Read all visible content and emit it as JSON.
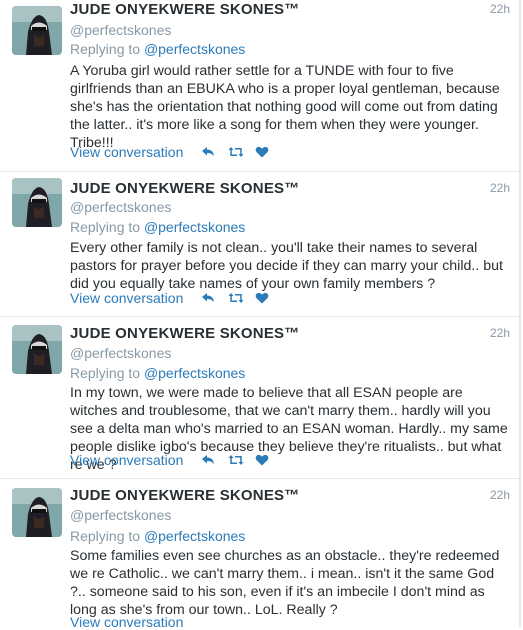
{
  "tweets": [
    {
      "name": "JUDE ONYEKWERE SKONES™",
      "handle": "@perfectskones",
      "time": "22h",
      "replying_prefix": "Replying to ",
      "replying_to": "@perfectskones",
      "text": "A Yoruba girl would rather settle for a TUNDE with four to five girlfriends than an EBUKA who is a proper loyal gentleman, because she's has the orientation that nothing good will come out from dating the latter.. it's more like a song for them when they were younger. Tribe!!!",
      "view_conversation": "View conversation"
    },
    {
      "name": "JUDE ONYEKWERE SKONES™",
      "handle": "@perfectskones",
      "time": "22h",
      "replying_prefix": "Replying to ",
      "replying_to": "@perfectskones",
      "text": "Every other family is not clean.. you'll take their names to several pastors for prayer before you decide if they can marry your child.. but did you equally take names of your own family members ?",
      "view_conversation": "View conversation"
    },
    {
      "name": "JUDE ONYEKWERE SKONES™",
      "handle": "@perfectskones",
      "time": "22h",
      "replying_prefix": "Replying to ",
      "replying_to": "@perfectskones",
      "text": "In my town, we were made to believe that all ESAN people are witches and troublesome, that we can't marry them.. hardly will you see a delta man who's married to an ESAN woman. Hardly.. my same people dislike igbo's because they believe they're ritualists.. but what re we ?",
      "view_conversation": "View conversation"
    },
    {
      "name": "JUDE ONYEKWERE SKONES™",
      "handle": "@perfectskones",
      "time": "22h",
      "replying_prefix": "Replying to ",
      "replying_to": "@perfectskones",
      "text": "Some families even see churches as an obstacle.. they're redeemed we re Catholic.. we can't marry them.. i mean.. isn't it the same God ?.. someone said to his son, even if it's an imbecile I don't mind as long as she's from our town.. LoL. Really ?",
      "view_conversation": "View conversation"
    }
  ],
  "icons": {
    "reply": "reply-icon",
    "retweet": "retweet-icon",
    "like": "heart-icon"
  },
  "colors": {
    "link": "#2b7bb9",
    "muted": "#8899a6",
    "text": "#292f33",
    "divider": "#e1e8ed"
  }
}
